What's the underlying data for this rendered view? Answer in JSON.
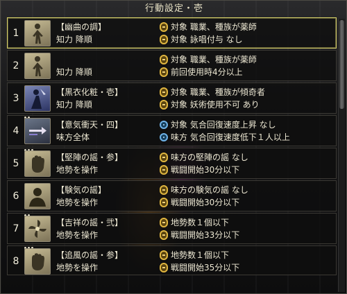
{
  "window": {
    "title": "行動設定・壱"
  },
  "rows": [
    {
      "num": "1",
      "icon": "figure-standing-icon",
      "skill": "【幽曲の調】",
      "target": "知力 降順",
      "conditions": [
        {
          "icon": "link-icon",
          "text": "対象 職業、種族が薬師"
        },
        {
          "icon": "link-icon",
          "text": "対象 詠唱付与 なし"
        }
      ]
    },
    {
      "num": "2",
      "icon": "figure-standing-icon",
      "skill": "",
      "target": "知力 降順",
      "conditions": [
        {
          "icon": "link-icon",
          "text": "対象 職業、種族が薬師"
        },
        {
          "icon": "link-icon",
          "text": "前回使用時4分以上"
        }
      ]
    },
    {
      "num": "3",
      "icon": "black-robe-icon",
      "skill": "【黒衣化粧・壱】",
      "target": "知力 降順",
      "conditions": [
        {
          "icon": "link-icon",
          "text": "対象 職業、種族が傾奇者"
        },
        {
          "icon": "link-icon",
          "text": "対象 妖術使用不可 あり"
        }
      ]
    },
    {
      "num": "4",
      "icon": "dash-arrow-icon",
      "skill": "【意気衝天・四】",
      "target": "味方全体",
      "conditions": [
        {
          "icon": "circle-icon",
          "text": "対象 気合回復速度上昇 なし"
        },
        {
          "icon": "circle-icon",
          "text": "味方 気合回復速度低下１人以上"
        }
      ]
    },
    {
      "num": "5",
      "icon": "fist-icon",
      "skill": "【堅陣の謡・参】",
      "target": "地勢を操作",
      "conditions": [
        {
          "icon": "link-icon",
          "text": "味方の堅陣の謡 なし"
        },
        {
          "icon": "link-icon",
          "text": "戦闘開始30分以下"
        }
      ]
    },
    {
      "num": "6",
      "icon": "silhouette-icon",
      "skill": "【験気の謡】",
      "target": "地勢を操作",
      "conditions": [
        {
          "icon": "link-icon",
          "text": "味方の験気の謡 なし"
        },
        {
          "icon": "link-icon",
          "text": "戦闘開始30分以下"
        }
      ]
    },
    {
      "num": "7",
      "icon": "swirl-icon",
      "skill": "【吉祥の謡・弐】",
      "target": "地勢を操作",
      "conditions": [
        {
          "icon": "link-icon",
          "text": "地勢数１個以下"
        },
        {
          "icon": "link-icon",
          "text": "戦闘開始33分以下"
        }
      ]
    },
    {
      "num": "8",
      "icon": "fist-icon",
      "skill": "【追風の謡・参】",
      "target": "地勢を操作",
      "conditions": [
        {
          "icon": "link-icon",
          "text": "地勢数１個以下"
        },
        {
          "icon": "link-icon",
          "text": "戦闘開始35分以下"
        }
      ]
    }
  ]
}
